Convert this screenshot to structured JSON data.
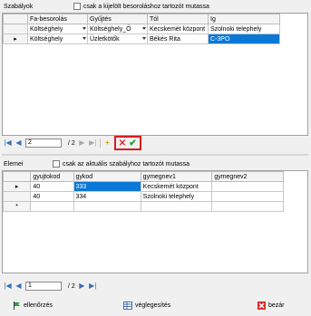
{
  "rules": {
    "title": "Szabályok",
    "filter_label": "csak a kijelölt besoroláshoz tartozót mutassa",
    "columns": [
      "Fa-besorolás",
      "Gyűjtés",
      "Tól",
      "Ig"
    ],
    "rows": [
      [
        "Költséghely",
        "Költséghely_Ö",
        "Kecskemét központ",
        "Szolnoki telephely"
      ],
      [
        "Költséghely",
        "Üzletkötők",
        "Békés Rita",
        "C-3PO"
      ]
    ],
    "current_row_marker": "▸",
    "nav": {
      "position": "2",
      "total": "/ 2"
    }
  },
  "elements": {
    "title": "Elemei",
    "filter_label": "csak az aktuális szabályhoz tartozót mutassa",
    "columns": [
      "gyujtokod",
      "gykod",
      "gymegnev1",
      "gymegnev2"
    ],
    "rows": [
      [
        "40",
        "333",
        "Kecskemét központ",
        ""
      ],
      [
        "40",
        "334",
        "Szolnoki telephely",
        ""
      ]
    ],
    "current_row_marker": "▸",
    "new_row_marker": "*",
    "nav": {
      "position": "1",
      "total": "/ 2"
    }
  },
  "footer": {
    "check_label": "ellenőrzés",
    "finalize_label": "véglegesítés",
    "close_label": "bezár"
  },
  "icons": {
    "first": "|◀",
    "prev": "◀",
    "next": "▶",
    "last": "▶|",
    "add": "+",
    "delete": "✕",
    "confirm": "✔"
  },
  "colors": {
    "selection": "#0a78d7",
    "highlight_box": "#d81e1e",
    "delete": "#e0242a",
    "confirm": "#1e9e2e",
    "add": "#e0a800"
  }
}
